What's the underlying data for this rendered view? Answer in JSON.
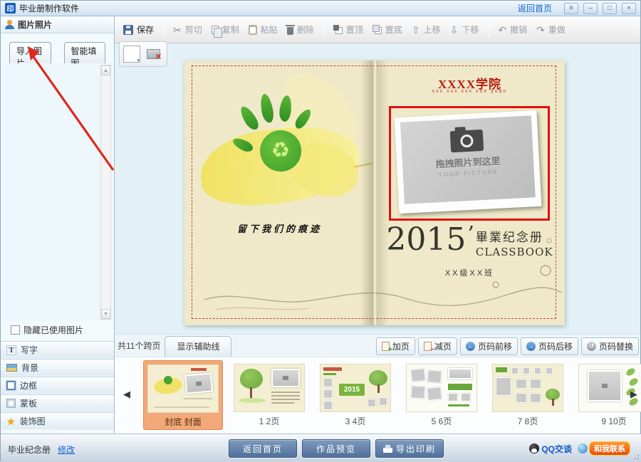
{
  "window": {
    "icon_text": "印",
    "title": "毕业册制作软件",
    "home_link": "返回首页",
    "skin": "≡",
    "minimize": "–",
    "maximize": "□",
    "close": "×"
  },
  "toolbar": {
    "save": "保存",
    "cut": "剪切",
    "copy": "复制",
    "paste": "粘贴",
    "delete": "删除",
    "to_front": "置顶",
    "to_back": "置底",
    "move_up": "上移",
    "move_down": "下移",
    "undo": "撤销",
    "redo": "重做"
  },
  "sidebar": {
    "header": "图片照片",
    "import_button": "导入图片",
    "smart_fill_button": "智能填图",
    "hide_used_label": "隐藏已使用图片",
    "panels": [
      {
        "label": "写字"
      },
      {
        "label": "背景"
      },
      {
        "label": "边框"
      },
      {
        "label": "蒙板"
      },
      {
        "label": "装饰图"
      }
    ]
  },
  "canvas": {
    "left_page_caption": "留下我们的痕迹",
    "college_name": "XXXX学院",
    "college_pinyin": "xxx xxx xxx  xue yuan",
    "photo_hint": "拖拽照片到这里",
    "photo_hint_en": "YOUR PICTURE",
    "year": "2015",
    "apostrophe": "’",
    "album_title": "畢業纪念册",
    "album_title_en": "CLASSBOOK",
    "class_name": "XX级XX班"
  },
  "pagebar": {
    "spread_count": "共11个跨页",
    "show_guides": "显示辅助线",
    "add_page": "加页",
    "remove_page": "减页",
    "page_forward": "页码前移",
    "page_backward": "页码后移",
    "page_swap": "页码替换"
  },
  "thumbnails": [
    {
      "label": "封底 封面",
      "selected": true
    },
    {
      "label": "1 2页"
    },
    {
      "label": "3 4页",
      "badge": "2015"
    },
    {
      "label": "5 6页"
    },
    {
      "label": "7 8页"
    },
    {
      "label": "9 10页"
    }
  ],
  "footer": {
    "project_name": "毕业纪念册",
    "modify_link": "修改",
    "home_button": "返回首页",
    "preview_button": "作品预览",
    "export_button": "导出印刷",
    "qq_chat": "QQ交谈",
    "contact": "和我联系"
  },
  "icons": {
    "recycle": "♻",
    "cut": "✂",
    "up": "⇧",
    "down": "⇩",
    "undo": "↶",
    "redo": "↷",
    "swap": "↺",
    "left_nav": "◀",
    "right_nav": "▶",
    "forward": "←",
    "backward": "→",
    "dropdown": "▾",
    "remove_x": "✕",
    "scroll_up": "▲",
    "scroll_down": "▼",
    "plus": "+",
    "minus": "−",
    "star": "★"
  },
  "colors": {
    "highlight_red": "#e01010",
    "selected_thumb": "#f3a878",
    "page_cream": "#efe9c9",
    "footer_button_blue": "#51719b"
  }
}
